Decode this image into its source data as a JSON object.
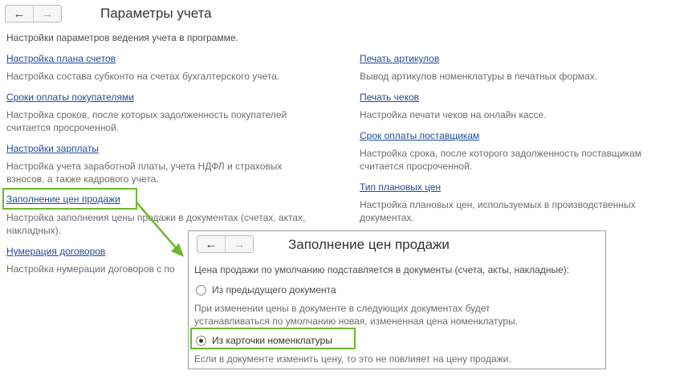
{
  "main": {
    "title": "Параметры учета",
    "subtitle": "Настройки параметров ведения учета в программе.",
    "left": [
      {
        "link": "Настройка плана счетов",
        "desc": "Настройка состава субконто на счетах бухгалтерского учета."
      },
      {
        "link": "Сроки оплаты покупателями",
        "desc": "Настройка сроков, после которых задолженность покупателей считается просроченной."
      },
      {
        "link": "Настройки зарплаты",
        "desc": "Настройка учета заработной платы, учета НДФЛ и страховых взносов, а также кадрового учета."
      },
      {
        "link": "Заполнение цен продажи",
        "desc": "Настройка заполнения цены продажи в документах (счетах, актах, накладных)."
      },
      {
        "link": "Нумерация договоров",
        "desc": "Настройка нумерации договоров с по"
      }
    ],
    "right": [
      {
        "link": "Печать артикулов",
        "desc": "Вывод артикулов номенклатуры в печатных формах."
      },
      {
        "link": "Печать чеков",
        "desc": "Настройка печати чеков на онлайн кассе."
      },
      {
        "link": "Срок оплаты поставщикам",
        "desc": "Настройка срока, после которого задолженность поставщикам считается просроченной."
      },
      {
        "link": "Тип плановых цен",
        "desc": "Настройка плановых цен, используемых в производственных документах."
      }
    ]
  },
  "nav": {
    "back_icon": "←",
    "forward_icon": "→"
  },
  "dialog": {
    "title": "Заполнение цен продажи",
    "question": "Цена продажи по умолчанию подставляется в документы (счета, акты, накладные):",
    "options": [
      {
        "label": "Из предыдущего документа",
        "selected": false,
        "hint": "При изменении цены в документе в следующих документах будет устанавливаться по умолчанию новая, измененная цена номенклатуры."
      },
      {
        "label": "Из карточки номенклатуры",
        "selected": true,
        "hint": "Если в документе изменить цену, то это не повлияет на цену продажи."
      }
    ]
  },
  "colors": {
    "link": "#1f4c9c",
    "highlight": "#6bb82f",
    "text": "#4d4d4d"
  }
}
